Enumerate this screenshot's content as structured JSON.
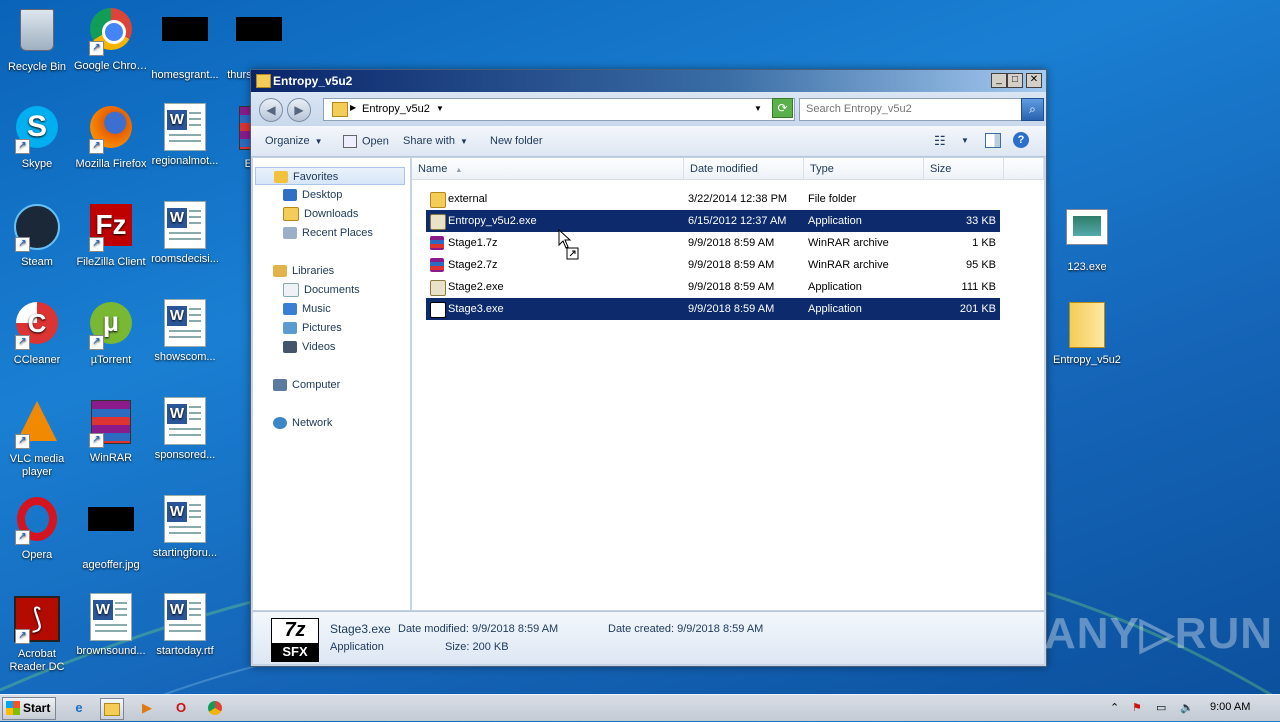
{
  "desktop": {
    "icons": [
      {
        "label": "Recycle Bin",
        "icon": "recycle-bin-icon"
      },
      {
        "label": "Google Chrome",
        "icon": "chrome-icon"
      },
      {
        "label": "homesgrant...",
        "icon": "black-thumbnail-icon"
      },
      {
        "label": "thursdayba...",
        "icon": "black-thumbnail-icon"
      },
      {
        "label": "Skype",
        "icon": "skype-icon"
      },
      {
        "label": "Mozilla Firefox",
        "icon": "firefox-icon"
      },
      {
        "label": "regionalmot...",
        "icon": "word-doc-icon"
      },
      {
        "label": "Entr...",
        "icon": "winrar-icon"
      },
      {
        "label": "Steam",
        "icon": "steam-icon"
      },
      {
        "label": "FileZilla Client",
        "icon": "filezilla-icon"
      },
      {
        "label": "roomsdecisi...",
        "icon": "word-doc-icon"
      },
      {
        "label": "CCleaner",
        "icon": "ccleaner-icon"
      },
      {
        "label": "µTorrent",
        "icon": "utorrent-icon"
      },
      {
        "label": "showscom...",
        "icon": "word-doc-icon"
      },
      {
        "label": "VLC media player",
        "icon": "vlc-icon"
      },
      {
        "label": "WinRAR",
        "icon": "winrar-icon"
      },
      {
        "label": "sponsored...",
        "icon": "word-doc-icon"
      },
      {
        "label": "Opera",
        "icon": "opera-icon"
      },
      {
        "label": "ageoffer.jpg",
        "icon": "black-thumbnail-icon"
      },
      {
        "label": "startingforu...",
        "icon": "word-doc-icon"
      },
      {
        "label": "Acrobat Reader DC",
        "icon": "acrobat-icon"
      },
      {
        "label": "brownsound...",
        "icon": "word-doc-icon"
      },
      {
        "label": "startoday.rtf",
        "icon": "word-doc-icon"
      },
      {
        "label": "123.exe",
        "icon": "exe-window-icon"
      },
      {
        "label": "Entropy_v5u2",
        "icon": "folder-icon"
      }
    ]
  },
  "window": {
    "title": "Entropy_v5u2",
    "address": "Entropy_v5u2",
    "search_placeholder": "Search Entropy_v5u2",
    "toolbar": {
      "organize": "Organize",
      "open": "Open",
      "share_with": "Share with",
      "new_folder": "New folder"
    },
    "nav": {
      "favorites": "Favorites",
      "desktop": "Desktop",
      "downloads": "Downloads",
      "recent_places": "Recent Places",
      "libraries": "Libraries",
      "documents": "Documents",
      "music": "Music",
      "pictures": "Pictures",
      "videos": "Videos",
      "computer": "Computer",
      "network": "Network"
    },
    "columns": [
      "Name",
      "Date modified",
      "Type",
      "Size"
    ],
    "files": [
      {
        "name": "external",
        "date": "3/22/2014 12:38 PM",
        "type": "File folder",
        "size": "",
        "icon": "folder-icon",
        "selected": false
      },
      {
        "name": "Entropy_v5u2.exe",
        "date": "6/15/2012 12:37 AM",
        "type": "Application",
        "size": "33 KB",
        "icon": "exe-icon",
        "selected": true
      },
      {
        "name": "Stage1.7z",
        "date": "9/9/2018 8:59 AM",
        "type": "WinRAR archive",
        "size": "1 KB",
        "icon": "winrar-archive-icon",
        "selected": false
      },
      {
        "name": "Stage2.7z",
        "date": "9/9/2018 8:59 AM",
        "type": "WinRAR archive",
        "size": "95 KB",
        "icon": "winrar-archive-icon",
        "selected": false
      },
      {
        "name": "Stage2.exe",
        "date": "9/9/2018 8:59 AM",
        "type": "Application",
        "size": "111 KB",
        "icon": "exe-icon",
        "selected": false
      },
      {
        "name": "Stage3.exe",
        "date": "9/9/2018 8:59 AM",
        "type": "Application",
        "size": "201 KB",
        "icon": "7z-sfx-icon",
        "selected": true
      }
    ],
    "details": {
      "icon_top": "7z",
      "icon_bottom": "SFX",
      "filename": "Stage3.exe",
      "type": "Application",
      "date_modified": "Date modified: 9/9/2018 8:59 AM",
      "size": "Size: 200 KB",
      "date_created": "Date created: 9/9/2018 8:59 AM"
    }
  },
  "taskbar": {
    "start_label": "Start",
    "clock": "9:00 AM"
  },
  "watermark": "ANY▷RUN"
}
